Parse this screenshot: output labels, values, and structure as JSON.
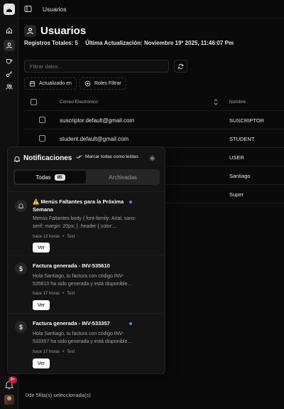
{
  "breadcrumb": "Usuarios",
  "page": {
    "title": "Usuarios",
    "total_label": "Registros Totales: 5",
    "updated_label": "Última Actualización: Noviembre 19º 2025, 11:46:07 Pm"
  },
  "filters": {
    "search_placeholder": "Filtrar datos...",
    "chip_updated": "Actualizado en",
    "chip_roles": "Roles Filtrar"
  },
  "table": {
    "headers": {
      "email": "Correo Electrónico",
      "name": "Nombre"
    },
    "rows": [
      {
        "email": "suscriptor.default@gmail.com",
        "name": "SUSCRIPTOR"
      },
      {
        "email": "student.default@gmail.com",
        "name": "STUDENT"
      },
      {
        "email": "",
        "name": "USER"
      },
      {
        "email": "",
        "name": "Santiago"
      },
      {
        "email": "",
        "name": "Super"
      }
    ],
    "footer": "0de 5fila(s) seleccionada(s)"
  },
  "notifications": {
    "title": "Notificaciones",
    "mark_all": "Marcar todas como leídas",
    "tab_all": "Todas",
    "tab_all_count": "85",
    "tab_archived": "Archivadas",
    "items": [
      {
        "title": "⚠️ Menús Faltantes para la Próxima Semana",
        "body": "Menús Faltantes body { font-family: Arial, sans-serif; margin: 20px; } .header { color:...",
        "time": "hace 13 horas",
        "type": "Text",
        "action": "Ver"
      },
      {
        "title": "Factura generada - INV-535610",
        "body": "Hola Santiago, tu factura con código INV-535610 ha sido generada y está disponible...",
        "time": "hace 17 horas",
        "type": "Text",
        "action": "Ver"
      },
      {
        "title": "Factura generada - INV-533357",
        "body": "Hola Santiago, tu factura con código INV-533357 ha sido generada y está disponible...",
        "time": "hace 17 horas",
        "type": "Text",
        "action": "Ver"
      }
    ],
    "badge": "9+"
  },
  "icons": {
    "logo": "app-logo-icon",
    "home": "home-icon",
    "users": "user-icon",
    "coffee": "coffee-icon",
    "key": "key-icon",
    "group": "users-icon",
    "bell": "bell-icon",
    "dollar": "dollar-icon"
  },
  "colors": {
    "unread_dot": "#6b7cf0",
    "badge": "#e11d48"
  }
}
